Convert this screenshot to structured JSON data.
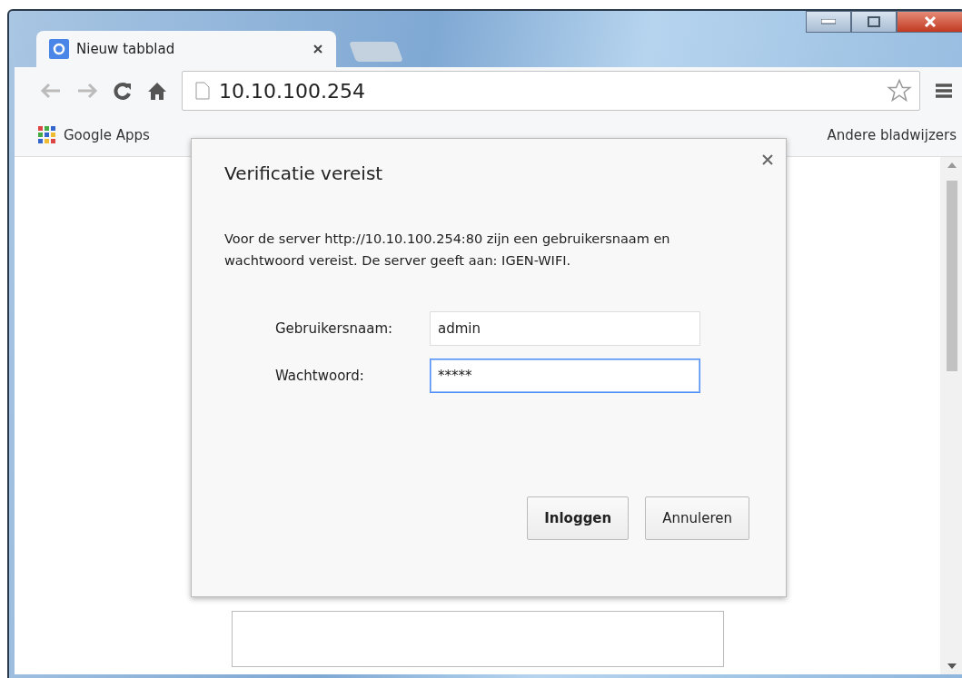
{
  "tabs": [
    {
      "label": "Nieuw tabblad",
      "selected": true
    }
  ],
  "address": "10.10.100.254",
  "bookmarks": [
    {
      "label": "Google Apps",
      "kind": "apps"
    },
    {
      "label": "Andere bladwijzers",
      "kind": "folder"
    }
  ],
  "dialog": {
    "title": "Verificatie vereist",
    "message": "Voor de server http://10.10.100.254:80 zijn een gebruikersnaam en wachtwoord vereist. De server geeft aan: IGEN-WIFI.",
    "fields": [
      {
        "label": "Gebruikersnaam:",
        "value": "admin",
        "focused": false
      },
      {
        "label": "Wachtwoord:",
        "value": "*****",
        "focused": true
      }
    ],
    "buttons": [
      {
        "label": "Inloggen",
        "primary": true
      },
      {
        "label": "Annuleren",
        "primary": false
      }
    ]
  }
}
